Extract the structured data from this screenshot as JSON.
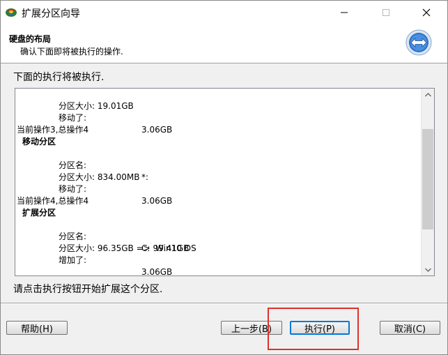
{
  "window": {
    "title": "扩展分区向导"
  },
  "header": {
    "title": "硬盘的布局",
    "subtitle": "确认下面即将被执行的操作."
  },
  "intro": "下面的执行将被执行.",
  "log": {
    "op2_tail": {
      "size_label": "分区大小:",
      "size_value": "19.01GB",
      "moved_label": "移动了:",
      "moved_value": "3.06GB"
    },
    "op3": {
      "heading": "当前操作3,总操作4",
      "action": "移动分区",
      "name_label": "分区名:",
      "name_value": "*:",
      "size_label": "分区大小:",
      "size_value": "834.00MB",
      "moved_label": "移动了:",
      "moved_value": "3.06GB"
    },
    "op4": {
      "heading": "当前操作4,总操作4",
      "action": "扩展分区",
      "name_label": "分区名:",
      "name_value": "C:  Win10 OS",
      "size_label": "分区大小:",
      "size_value": "96.35GB => 99.41GB",
      "added_label": "增加了:",
      "added_value": "3.06GB"
    }
  },
  "hint": "请点击执行按钮开始扩展这个分区.",
  "buttons": {
    "help": "帮助(H)",
    "prev": "上一步(B)",
    "execute": "执行(P)",
    "cancel": "取消(C)"
  },
  "colors": {
    "highlight": "#e0302a",
    "accent": "#0078d7"
  },
  "scroll": {
    "thumb_position_fraction": 0.45
  }
}
